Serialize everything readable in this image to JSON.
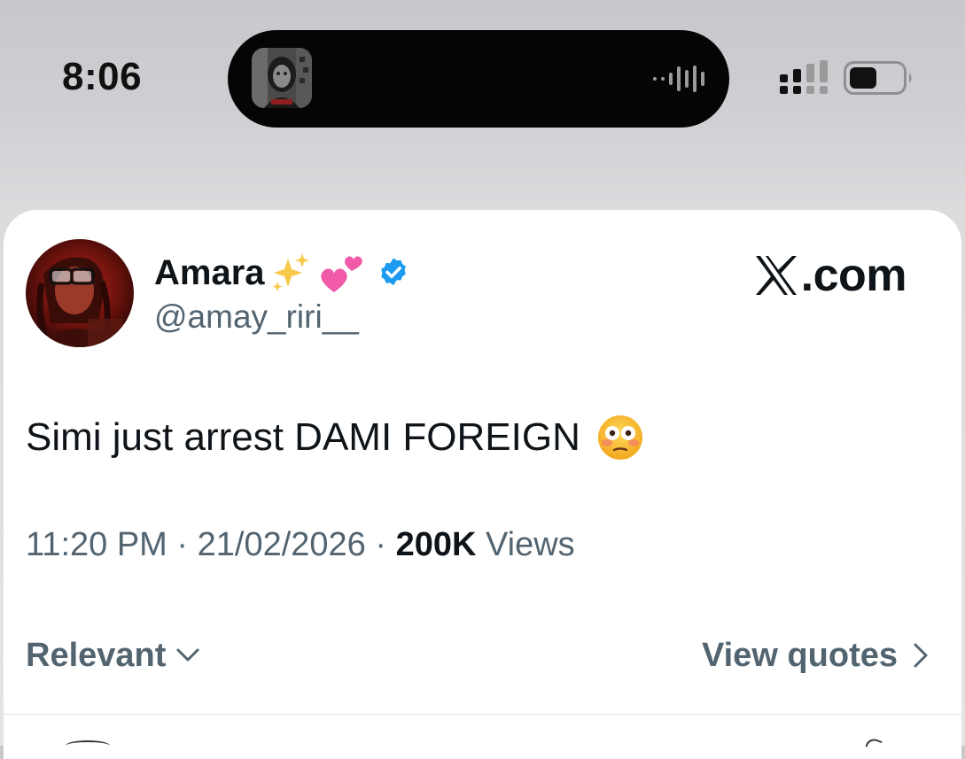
{
  "status_bar": {
    "time": "8:06",
    "island_artwork_icon": "album-art-icon",
    "island_activity_icon": "audio-waveform-icon",
    "signal_icon": "cellular-signal-icon",
    "battery_icon": "battery-icon"
  },
  "tweet": {
    "display_name": "Amara",
    "name_emoji": "✨💕",
    "verified_icon": "verified-badge-icon",
    "handle": "@amay_riri__",
    "brand": ".com",
    "brand_icon": "x-logo-icon",
    "text": "Simi just arrest DAMI FOREIGN",
    "text_emoji": "😳",
    "time": "11:20 PM",
    "separator": "·",
    "date": "21/02/2026",
    "views_count": "200K",
    "views_label": "Views"
  },
  "controls": {
    "sort_label": "Relevant",
    "sort_icon": "chevron-down-icon",
    "quotes_label": "View quotes",
    "quotes_icon": "chevron-right-icon"
  },
  "colors": {
    "primary_text": "#0f1419",
    "secondary_text": "#536471",
    "verified_blue": "#1d9bf0",
    "card_background": "#ffffff"
  }
}
